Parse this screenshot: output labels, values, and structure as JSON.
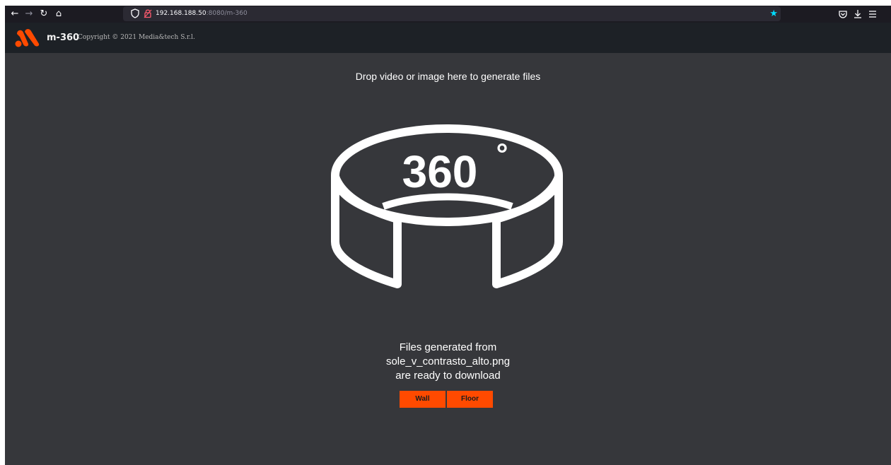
{
  "browser": {
    "url_host": "192.168.188.50",
    "url_rest": ":8080/m-360",
    "icons": [
      "back-icon",
      "forward-icon",
      "reload-icon",
      "home-icon",
      "shield-icon",
      "lock-icon",
      "bookmark-star-icon",
      "pocket-icon",
      "download-icon",
      "menu-icon"
    ],
    "star_color": "#00ddff"
  },
  "header": {
    "app_name": "m-360",
    "copyright": "Copyright © 2021 Media&tech S.r.l.",
    "logo_color": "#ff4a00",
    "background": "#1d2126"
  },
  "main": {
    "drop_hint": "Drop video or image here to generate files",
    "icon_label": "360",
    "icon_degree": "°",
    "status_line1": "Files generated from",
    "status_line2": "sole_v_contrasto_alto.png",
    "status_line3": "are ready to download",
    "background": "#36373b"
  },
  "buttons": {
    "wall_label": "Wall",
    "floor_label": "Floor",
    "color": "#ff4a00"
  }
}
